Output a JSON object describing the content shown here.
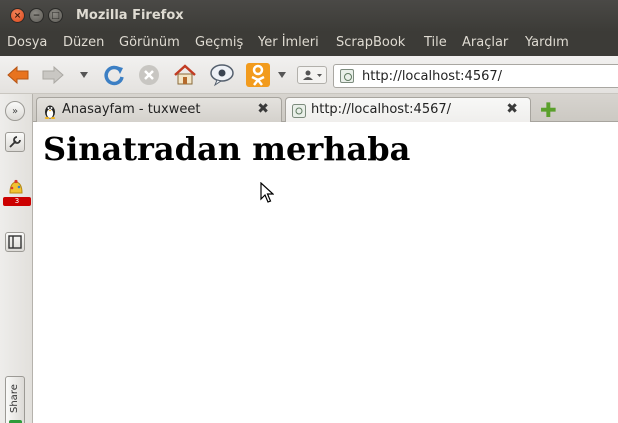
{
  "window": {
    "title": "Mozilla Firefox"
  },
  "menu": [
    "Dosya",
    "Düzen",
    "Görünüm",
    "Geçmiş",
    "Yer İmleri",
    "ScrapBook",
    "Tile",
    "Araçlar",
    "Yardım"
  ],
  "navbar": {
    "url": "http://localhost:4567/"
  },
  "sidebar": {
    "badge_count": "3",
    "share_label": "Share"
  },
  "tabs": [
    {
      "label": "Anasayfam - tuxweet",
      "active": false
    },
    {
      "label": "http://localhost:4567/",
      "active": true
    }
  ],
  "page": {
    "heading": "Sinatradan merhaba"
  },
  "colors": {
    "titlebar": "#3c3b37",
    "accent_close": "#e95420",
    "newtab_plus": "#5aa02c",
    "badge": "#cc0000"
  }
}
